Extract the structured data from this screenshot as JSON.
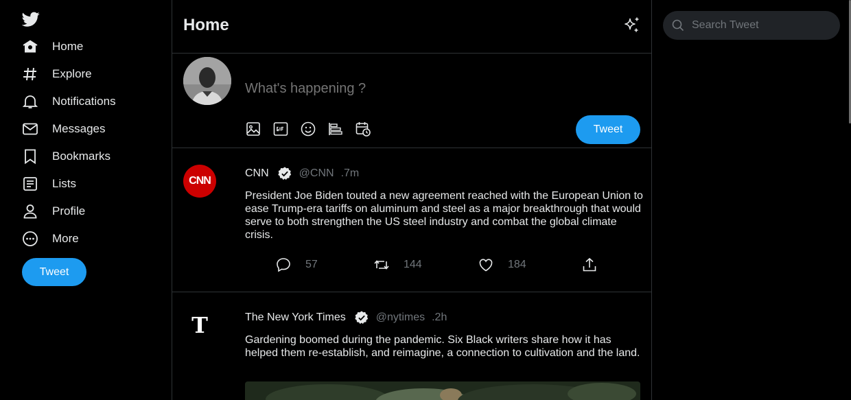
{
  "nav": {
    "items": [
      {
        "label": "Home"
      },
      {
        "label": "Explore"
      },
      {
        "label": "Notifications"
      },
      {
        "label": "Messages"
      },
      {
        "label": "Bookmarks"
      },
      {
        "label": "Lists"
      },
      {
        "label": "Profile"
      },
      {
        "label": "More"
      }
    ],
    "tweet_button": "Tweet"
  },
  "header": {
    "title": "Home"
  },
  "composer": {
    "placeholder": "What's happening ?",
    "tweet_button": "Tweet"
  },
  "tweets": [
    {
      "name": "CNN",
      "handle": "@CNN",
      "time": ".7m",
      "text": "President Joe Biden touted a new agreement reached with the European Union to ease Trump-era tariffs on aluminum and steel as a major breakthrough that would serve to both strengthen the US steel industry and combat the global climate crisis.",
      "replies": "57",
      "retweets": "144",
      "likes": "184",
      "avatar_text": "CNN"
    },
    {
      "name": "The New York Times",
      "handle": "@nytimes",
      "time": ".2h",
      "text": "Gardening boomed during the pandemic. Six Black writers share how it has helped them re-establish, and reimagine, a connection to cultivation and the land.",
      "avatar_text": "T"
    }
  ],
  "search": {
    "placeholder": "Search Tweet"
  },
  "colors": {
    "accent": "#1d9bf0",
    "background": "#000000",
    "border": "#2f3336",
    "muted": "#71767b",
    "cnn_red": "#cc0000"
  }
}
